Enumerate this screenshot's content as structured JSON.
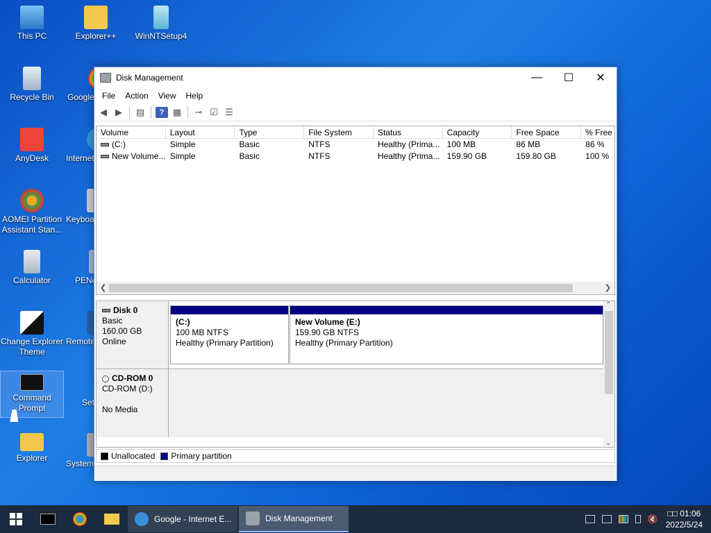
{
  "desktop": {
    "icons": [
      {
        "label": "This PC"
      },
      {
        "label": "Explorer++"
      },
      {
        "label": "WinNTSetup4"
      },
      {
        "label": "Recycle Bin"
      },
      {
        "label": "Google"
      },
      {
        "label": "AnyDesk"
      },
      {
        "label": "Internet"
      },
      {
        "label": "AOMEI Partition Assistant Stan..."
      },
      {
        "label": "Keyboa"
      },
      {
        "label": "Calculator"
      },
      {
        "label": "PENe"
      },
      {
        "label": "Change Explorer Theme"
      },
      {
        "label": "Remote"
      },
      {
        "label": "Command Prompt"
      },
      {
        "label": "Set Reso"
      },
      {
        "label": "Explorer"
      },
      {
        "label": "System"
      }
    ]
  },
  "window": {
    "title": "Disk Management",
    "minimize": "—",
    "maximize": "☐",
    "close": "✕"
  },
  "menu": [
    "File",
    "Action",
    "View",
    "Help"
  ],
  "volumes": {
    "columns": [
      "Volume",
      "Layout",
      "Type",
      "File System",
      "Status",
      "Capacity",
      "Free Space",
      "% Free"
    ],
    "rows": [
      [
        "(C:)",
        "Simple",
        "Basic",
        "NTFS",
        "Healthy (Prima...",
        "100 MB",
        "86 MB",
        "86 %"
      ],
      [
        "New Volume...",
        "Simple",
        "Basic",
        "NTFS",
        "Healthy (Prima...",
        "159.90 GB",
        "159.80 GB",
        "100 %"
      ]
    ]
  },
  "disks": [
    {
      "name": "Disk 0",
      "type": "Basic",
      "size": "160.00 GB",
      "state": "Online",
      "partitions": [
        {
          "name": "(C:)",
          "size": "100 MB NTFS",
          "status": "Healthy (Primary Partition)"
        },
        {
          "name": "New Volume  (E:)",
          "size": "159.90 GB NTFS",
          "status": "Healthy (Primary Partition)"
        }
      ]
    },
    {
      "name": "CD-ROM 0",
      "type": "CD-ROM (D:)",
      "state": "No Media"
    }
  ],
  "legend": {
    "unallocated": "Unallocated",
    "primary": "Primary partition",
    "unallocated_color": "#000000",
    "primary_color": "#000080"
  },
  "taskbar": {
    "tasks": [
      {
        "label": "Google - Internet E..."
      },
      {
        "label": "Disk Management"
      }
    ],
    "time": "01:06",
    "time_prefix": "□□",
    "date": "2022/5/24"
  }
}
